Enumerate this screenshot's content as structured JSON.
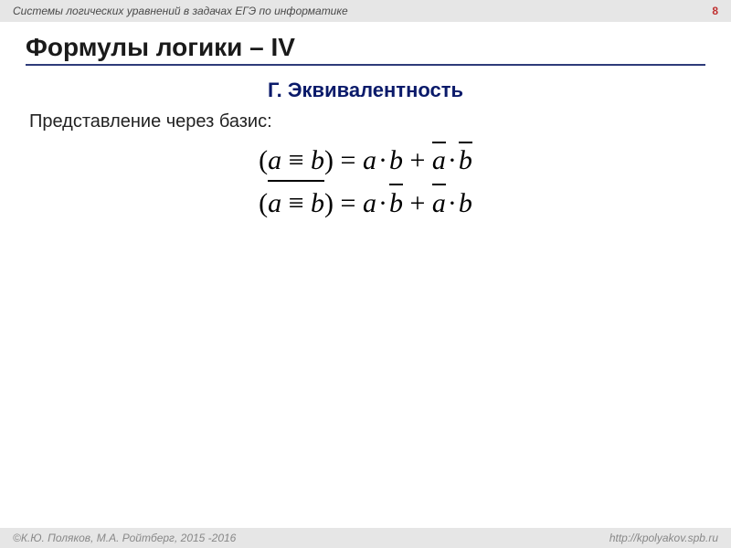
{
  "header": {
    "topic": "Системы логических уравнений в задачах ЕГЭ по информатике",
    "page_number": "8"
  },
  "title": "Формулы логики – IV",
  "subtitle": "Г. Эквивалентность",
  "intro": "Представление через базис:",
  "formulas": {
    "line1": {
      "lhs_open": "(",
      "a": "a",
      "equiv": " ≡ ",
      "b": "b",
      "lhs_close": ")",
      "eq": " = ",
      "dot": "·",
      "plus": " + "
    },
    "line2": {
      "lhs_open": "(",
      "a": "a",
      "equiv": " ≡ ",
      "b": "b",
      "lhs_close": ")",
      "eq": " = ",
      "dot": "·",
      "plus": " + "
    }
  },
  "footer": {
    "authors": "©К.Ю. Поляков, М.А. Ройтберг, 2015 -2016",
    "url": "http://kpolyakov.spb.ru"
  }
}
